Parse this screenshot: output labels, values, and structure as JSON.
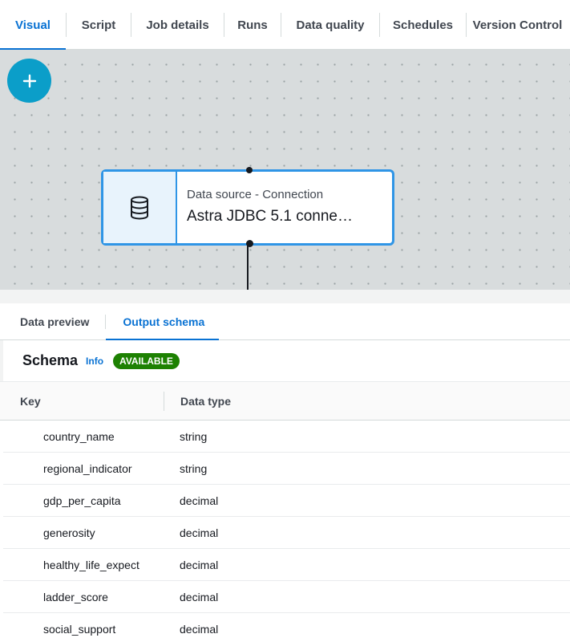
{
  "tabs": [
    "Visual",
    "Script",
    "Job details",
    "Runs",
    "Data quality",
    "Schedules",
    "Version Control"
  ],
  "active_tab": "Visual",
  "canvas": {
    "add_button_symbol": "+",
    "node": {
      "icon": "database-icon",
      "subtitle": "Data source - Connection",
      "title": "Astra JDBC 5.1 conne…"
    }
  },
  "panel": {
    "tabs": [
      "Data preview",
      "Output schema"
    ],
    "active_tab": "Output schema",
    "schema": {
      "title": "Schema",
      "info": "Info",
      "status": "AVAILABLE"
    },
    "columns": [
      "Key",
      "Data type"
    ],
    "rows": [
      {
        "key": "country_name",
        "type": "string"
      },
      {
        "key": "regional_indicator",
        "type": "string"
      },
      {
        "key": "gdp_per_capita",
        "type": "decimal"
      },
      {
        "key": "generosity",
        "type": "decimal"
      },
      {
        "key": "healthy_life_expectancy",
        "type": "decimal"
      },
      {
        "key": "ladder_score",
        "type": "decimal"
      },
      {
        "key": "social_support",
        "type": "decimal"
      }
    ]
  },
  "colors": {
    "accent": "#0972d3",
    "add_button": "#0b9ec9",
    "node_border": "#2f95e6",
    "status_badge": "#1d8102"
  }
}
